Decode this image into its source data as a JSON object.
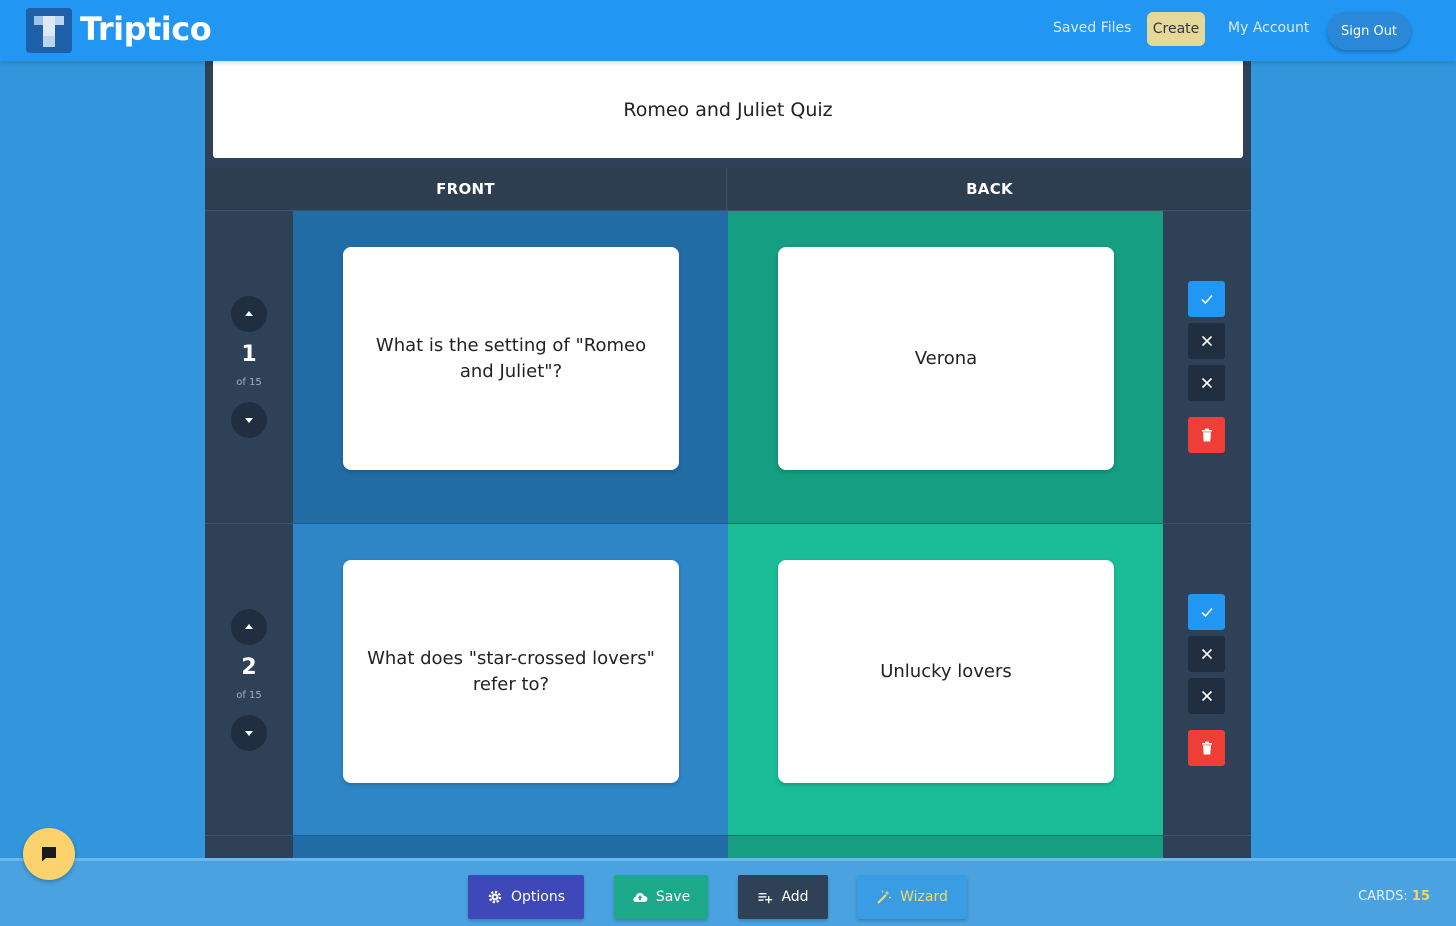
{
  "header": {
    "brand": "Triptico",
    "nav": {
      "saved_files": "Saved Files",
      "create": "Create",
      "my_account": "My Account",
      "sign_out": "Sign Out"
    }
  },
  "quiz": {
    "title": "Romeo and Juliet Quiz",
    "columns": {
      "front": "FRONT",
      "back": "BACK"
    },
    "rows": [
      {
        "number": "1",
        "of": "of 15",
        "front": "What is the setting of \"Romeo and Juliet\"?",
        "back": "Verona"
      },
      {
        "number": "2",
        "of": "of 15",
        "front": "What does \"star-crossed lovers\" refer to?",
        "back": "Unlucky lovers"
      }
    ]
  },
  "toolbar": {
    "options": "Options",
    "save": "Save",
    "add": "Add",
    "wizard": "Wizard",
    "cards_label": "CARDS:",
    "cards_count": "15"
  },
  "icons": {
    "row_up": "chevron-up-icon",
    "row_down": "chevron-down-icon",
    "check": "check-icon",
    "close": "close-icon",
    "delete": "trash-icon",
    "options": "gear-icon",
    "save": "cloud-upload-icon",
    "add": "playlist-add-icon",
    "wizard": "magic-wand-icon",
    "chat": "chat-bubble-icon"
  },
  "colors": {
    "header": "#2196f3",
    "create_highlight": "#e5d99a",
    "check": "#2196f3",
    "delete": "#ef3e36",
    "options": "#3f48b9",
    "save": "#1ba98a",
    "cards_count": "#f6d55c",
    "chat": "#fbd26b"
  }
}
